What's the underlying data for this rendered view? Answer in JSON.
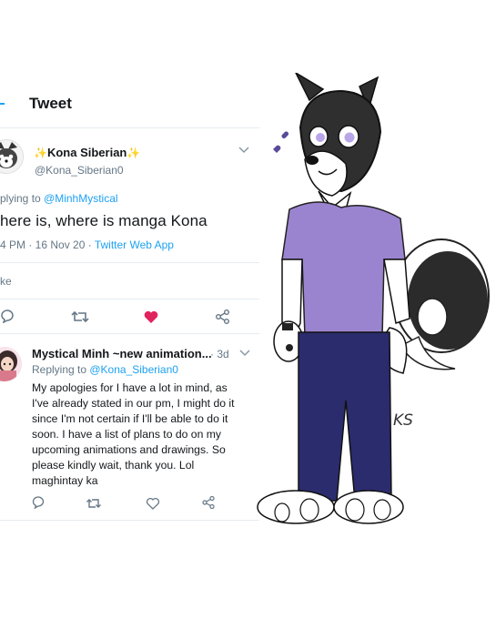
{
  "header": {
    "title": "Tweet"
  },
  "tweet": {
    "sparkle_left": "✨",
    "name": "Kona Siberian",
    "sparkle_right": "✨",
    "handle": "@Kona_Siberian0",
    "reply_prefix": "plying to ",
    "reply_handle": "@MinhMystical",
    "text": "here is, where is manga Kona",
    "timestamp": "4 PM · 16 Nov 20 · ",
    "source": "Twitter Web App",
    "likes_partial": "ke"
  },
  "reply": {
    "name": "Mystical Minh ~new animation...",
    "time": "· 3d",
    "reply_prefix": "Replying to ",
    "reply_handle": "@Kona_Siberian0",
    "lines": [
      "My apologies for I have a lot in mind, as",
      "I've already stated in our pm, I might do it",
      "since I'm not certain if I'll be able to do it",
      "soon. I have a list of plans to do on my",
      "upcoming animations and drawings. So",
      "please kindly wait, thank you. Lol",
      "maghintay ka"
    ]
  },
  "drawing": {
    "signature": "KS"
  },
  "colors": {
    "like_red": "#e0245e",
    "link_blue": "#1da1f2",
    "shirt_purple": "#9b84cf",
    "pants_navy": "#2b2c6e",
    "fur_dark": "#3a3a3a"
  }
}
